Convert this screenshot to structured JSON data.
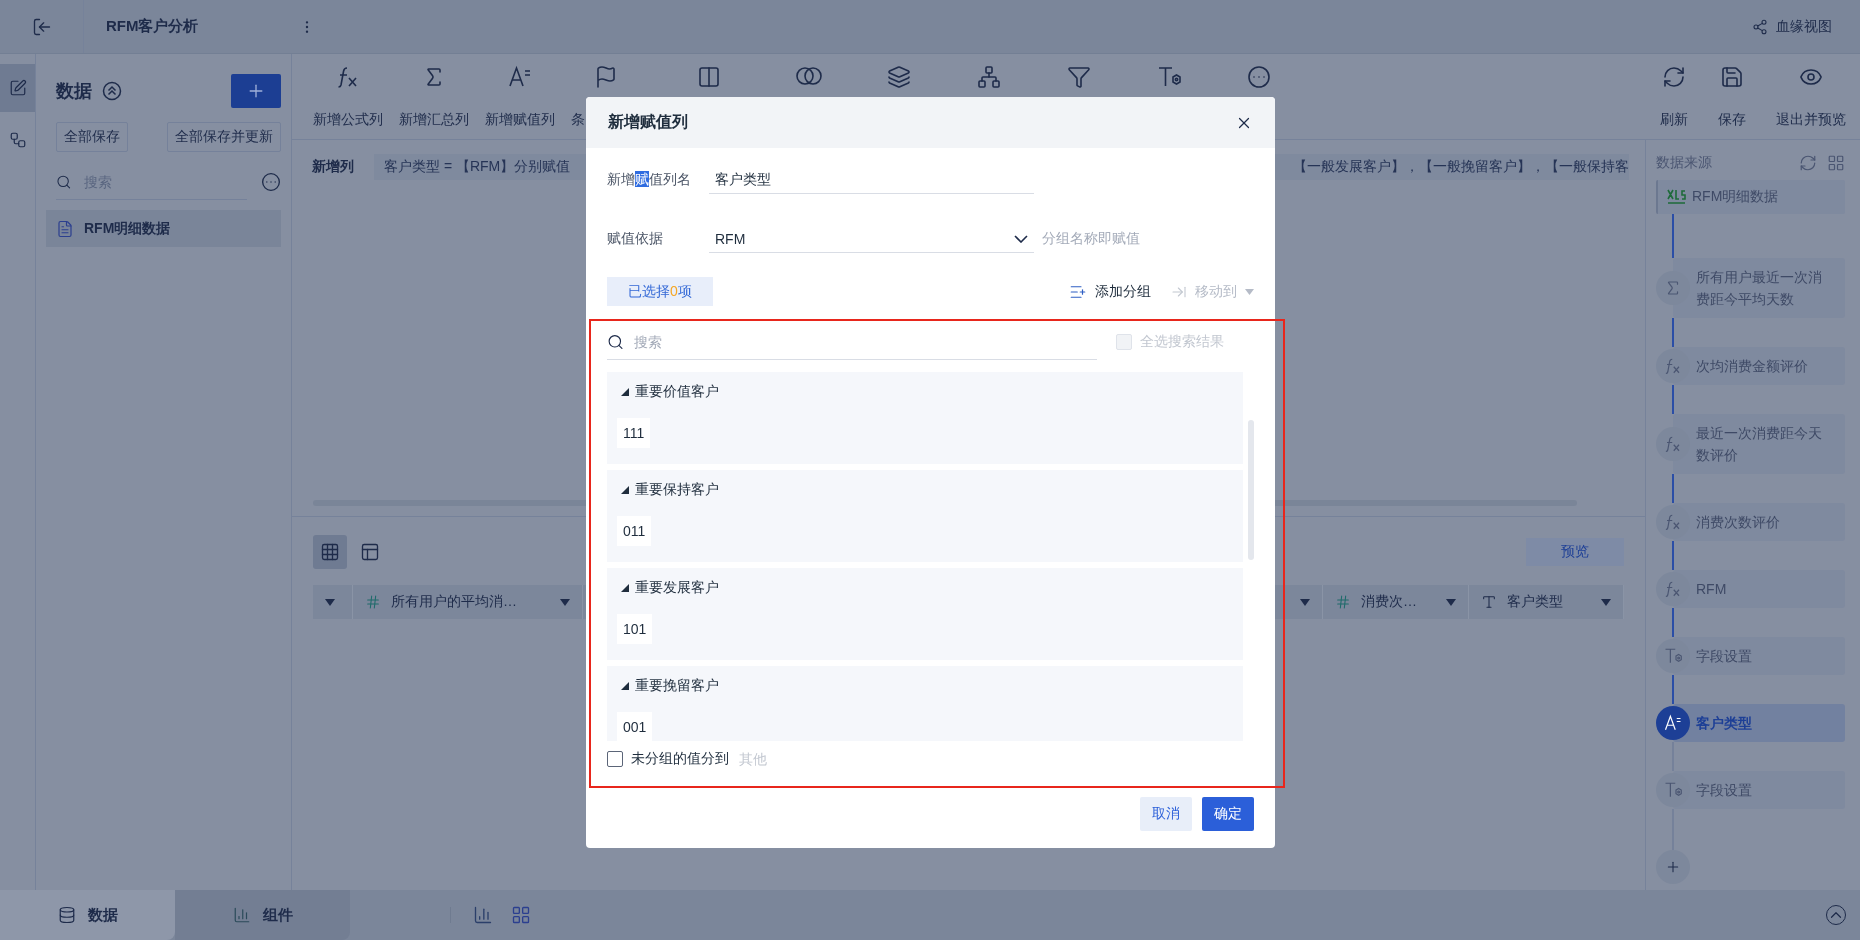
{
  "top_bar": {
    "title": "RFM客户分析",
    "lineage": "血缘视图"
  },
  "rail": [
    {
      "kind": "data",
      "selected": true
    },
    {
      "kind": "flow",
      "selected": false
    }
  ],
  "data_panel": {
    "title": "数据",
    "buttons": [
      "全部保存",
      "全部保存并更新"
    ],
    "search": {
      "placeholder": "搜索"
    },
    "items": [
      {
        "label": "RFM明细数据",
        "selected": true
      }
    ]
  },
  "toolbar": {
    "items": [
      {
        "kind": "formula",
        "label": "新增公式列"
      },
      {
        "kind": "summary",
        "label": "新增汇总列"
      },
      {
        "kind": "assign",
        "label": "新增赋值列"
      },
      {
        "kind": "condition",
        "label": "条"
      },
      {
        "kind": "columns"
      },
      {
        "kind": "merge"
      },
      {
        "kind": "database"
      },
      {
        "kind": "tree"
      },
      {
        "kind": "filter"
      },
      {
        "kind": "field_settings"
      },
      {
        "kind": "more"
      }
    ],
    "actions": [
      {
        "kind": "refresh",
        "label": "刷新"
      },
      {
        "kind": "save",
        "label": "保存"
      },
      {
        "kind": "preview",
        "label": "退出并预览"
      }
    ]
  },
  "formula": {
    "label": "新增列",
    "text_start": "客户类型 = 【RFM】分别赋值",
    "text_end": "【一般发展客户】，【一般挽留客户】，【一般保持客"
  },
  "views": [
    {
      "kind": "grid",
      "selected": true
    },
    {
      "kind": "layout",
      "selected": false
    }
  ],
  "preview_button": "预览",
  "table": {
    "columns": [
      {
        "kind": "menu"
      },
      {
        "kind": "number",
        "label": "所有用户的平均消…"
      },
      {
        "kind": "menu"
      },
      {
        "kind": "number",
        "label": "消费次…"
      },
      {
        "kind": "text",
        "label": "客户类型"
      }
    ]
  },
  "flow": {
    "title": "数据来源",
    "nodes": [
      {
        "kind": "source",
        "label": "RFM明细数据",
        "selected": false
      },
      {
        "kind": "summary",
        "label": "所有用户最近一次消费距今平均天数",
        "selected": false
      },
      {
        "kind": "formula",
        "label": "次均消费金额评价",
        "selected": false
      },
      {
        "kind": "formula",
        "label": "最近一次消费距今天数评价",
        "selected": false
      },
      {
        "kind": "formula",
        "label": "消费次数评价",
        "selected": false
      },
      {
        "kind": "formula",
        "label": "RFM",
        "selected": false
      },
      {
        "kind": "field_settings",
        "label": "字段设置",
        "selected": false
      },
      {
        "kind": "assign",
        "label": "客户类型",
        "selected": true
      },
      {
        "kind": "field_settings",
        "label": "字段设置",
        "selected": false
      }
    ]
  },
  "bottom_tabs": [
    {
      "kind": "data",
      "label": "数据",
      "selected": true
    },
    {
      "kind": "component",
      "label": "组件",
      "selected": false
    }
  ],
  "dialog": {
    "title": "新增赋值列",
    "name_field": {
      "label": {
        "before": "新增",
        "selected": "赋",
        "after": "值列名"
      },
      "value": "客户类型"
    },
    "basis": {
      "label": "赋值依据",
      "value": "RFM",
      "hint": "分组名称即赋值"
    },
    "selected_tab": {
      "prefix": "已选择",
      "count": "0",
      "suffix": "项"
    },
    "add_group": "添加分组",
    "move_to": {
      "label": "移动到",
      "disabled": true
    },
    "search": {
      "placeholder": "搜索"
    },
    "select_all": {
      "label": "全选搜索结果",
      "checked": false,
      "disabled": true
    },
    "groups": [
      {
        "name": "重要价值客户",
        "expanded": true,
        "values": [
          "111"
        ]
      },
      {
        "name": "重要保持客户",
        "expanded": true,
        "values": [
          "011"
        ]
      },
      {
        "name": "重要发展客户",
        "expanded": true,
        "values": [
          "101"
        ]
      },
      {
        "name": "重要挽留客户",
        "expanded": true,
        "values": [
          "001"
        ]
      }
    ],
    "ungrouped": {
      "label": "未分组的值分到",
      "checked": false,
      "placeholder": "其他"
    },
    "buttons": [
      {
        "kind": "secondary",
        "label": "取消"
      },
      {
        "kind": "primary",
        "label": "确定"
      }
    ]
  }
}
